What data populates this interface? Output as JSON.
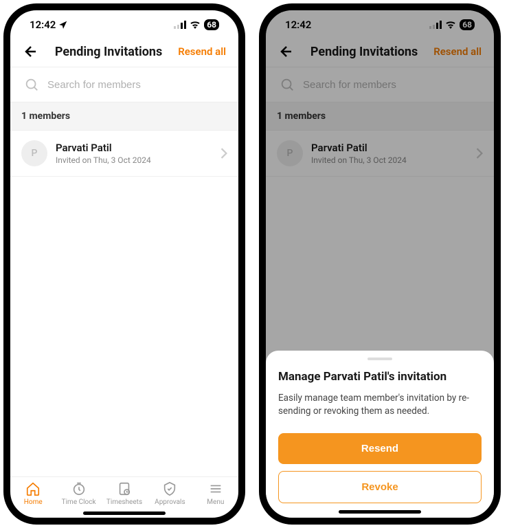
{
  "status": {
    "time": "12:42",
    "battery": "68"
  },
  "header": {
    "title": "Pending Invitations",
    "action": "Resend all"
  },
  "search": {
    "placeholder": "Search for members"
  },
  "section": {
    "label": "1 members"
  },
  "member": {
    "initial": "P",
    "name": "Parvati Patil",
    "sub": "Invited on Thu, 3 Oct 2024"
  },
  "tabs": {
    "home": "Home",
    "timeclock": "Time Clock",
    "timesheets": "Timesheets",
    "approvals": "Approvals",
    "menu": "Menu"
  },
  "sheet": {
    "title": "Manage Parvati Patil's invitation",
    "desc": "Easily manage team member's invitation by re-sending or revoking them as needed.",
    "resend": "Resend",
    "revoke": "Revoke"
  }
}
